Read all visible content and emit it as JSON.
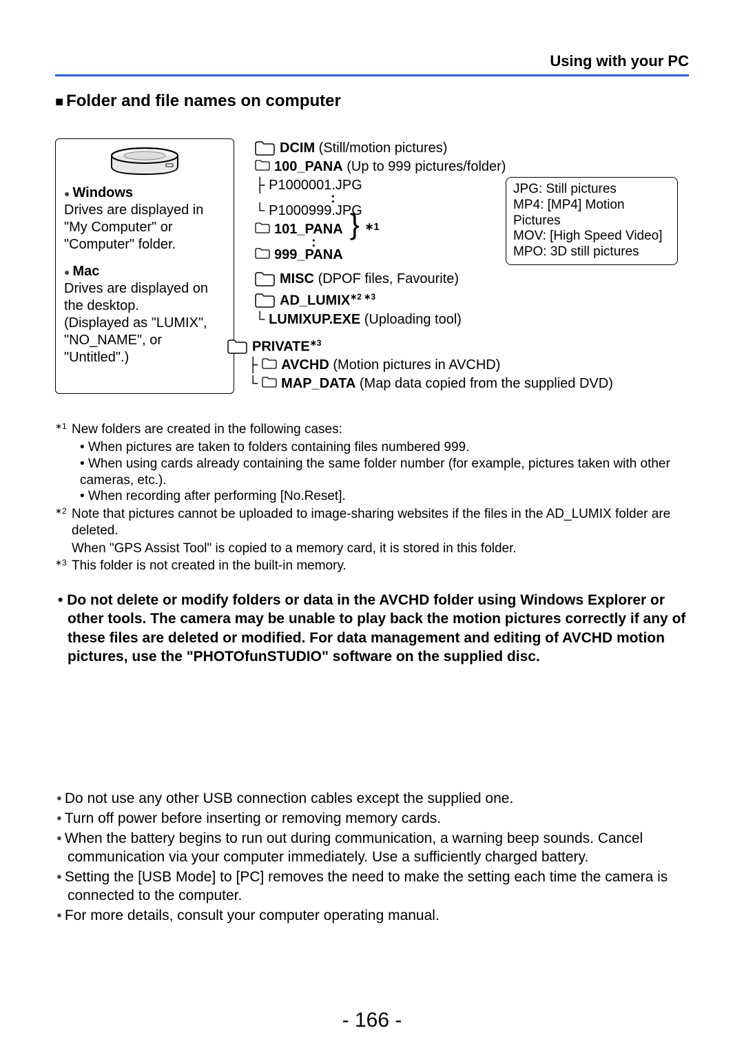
{
  "header": {
    "section": "Using with your PC"
  },
  "title": "Folder and file names on computer",
  "left": {
    "windows": {
      "head": "Windows",
      "body": "Drives are displayed in \"My Computer\" or \"Computer\" folder."
    },
    "mac": {
      "head": "Mac",
      "body": "Drives are displayed on the desktop.\n(Displayed as \"LUMIX\", \"NO_NAME\", or \"Untitled\".)"
    }
  },
  "tree": {
    "dcim": {
      "name": "DCIM",
      "desc": "(Still/motion pictures)"
    },
    "pana100": {
      "name": "100_PANA",
      "desc": "(Up to 999 pictures/folder)"
    },
    "file_first": "P1000001.JPG",
    "file_last": "P1000999.JPG",
    "pana101": {
      "name": "101_PANA"
    },
    "pana999": {
      "name": "999_PANA"
    },
    "ref1": "∗1",
    "misc": {
      "name": "MISC",
      "desc": "(DPOF files, Favourite)"
    },
    "adlumix": {
      "name": "AD_LUMIX",
      "sup": "∗2 ∗3"
    },
    "lumixup": {
      "name": "LUMIXUP.EXE",
      "desc": "(Uploading tool)"
    },
    "private": {
      "name": "PRIVATE",
      "sup": "∗3"
    },
    "avchd": {
      "name": "AVCHD",
      "desc": "(Motion pictures in AVCHD)"
    },
    "mapdata": {
      "name": "MAP_DATA",
      "desc": "(Map data copied from the supplied DVD)"
    }
  },
  "filetypes": {
    "jpg": "JPG: Still pictures",
    "mp4": "MP4: [MP4] Motion Pictures",
    "mov": "MOV: [High Speed Video]",
    "mpo": "MPO: 3D still pictures"
  },
  "notes": {
    "n1_head": "New folders are created in the following cases:",
    "n1_a": "When pictures are taken to folders containing files numbered 999.",
    "n1_b": "When using cards already containing the same folder number (for example, pictures taken with other cameras, etc.).",
    "n1_c": "When recording after performing [No.Reset].",
    "n2_a": "Note that pictures cannot be uploaded to image-sharing websites if the files in the AD_LUMIX folder are deleted.",
    "n2_b": "When \"GPS Assist Tool\" is copied to a memory card, it is stored in this folder.",
    "n3": "This folder is not created in the built-in memory."
  },
  "warning": "Do not delete or modify folders or data in the AVCHD folder using Windows Explorer or other tools. The camera may be unable to play back the motion pictures correctly if any of these files are deleted or modified. For data management and editing of AVCHD motion pictures, use the \"PHOTOfunSTUDIO\" software on the supplied disc.",
  "bottom": {
    "b1": "Do not use any other USB connection cables except the supplied one.",
    "b2": "Turn off power before inserting or removing memory cards.",
    "b3": "When the battery begins to run out during communication, a warning beep sounds. Cancel communication via your computer immediately. Use a sufficiently charged battery.",
    "b4": "Setting the [USB Mode] to [PC] removes the need to make the setting each time the camera is connected to the computer.",
    "b5": "For more details, consult your computer operating manual."
  },
  "page_number": "- 166 -"
}
